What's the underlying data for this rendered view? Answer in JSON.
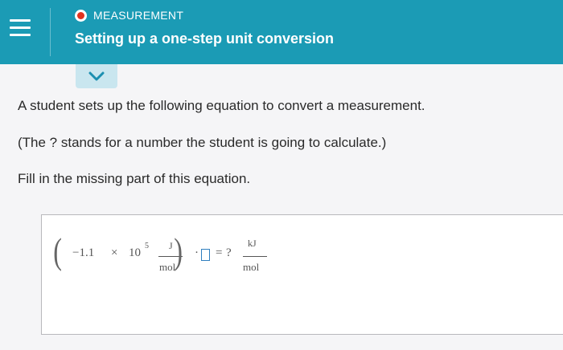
{
  "header": {
    "topic": "MEASUREMENT",
    "title": "Setting up a one-step unit conversion",
    "status_color": "#e2331e",
    "background_color": "#1b9bb5"
  },
  "question": {
    "line1": "A student sets up the following equation to convert a measurement.",
    "line2": "(The ? stands for a number the student is going to calculate.)",
    "line3": "Fill in the missing part of this equation."
  },
  "equation": {
    "coefficient": "−1.1",
    "times": "×",
    "base": "10",
    "exponent": "5",
    "left_unit_numerator": "J",
    "left_unit_denominator": "mol",
    "dot": "·",
    "equals": "=",
    "unknown": "?",
    "right_unit_numerator": "kJ",
    "right_unit_denominator": "mol"
  }
}
